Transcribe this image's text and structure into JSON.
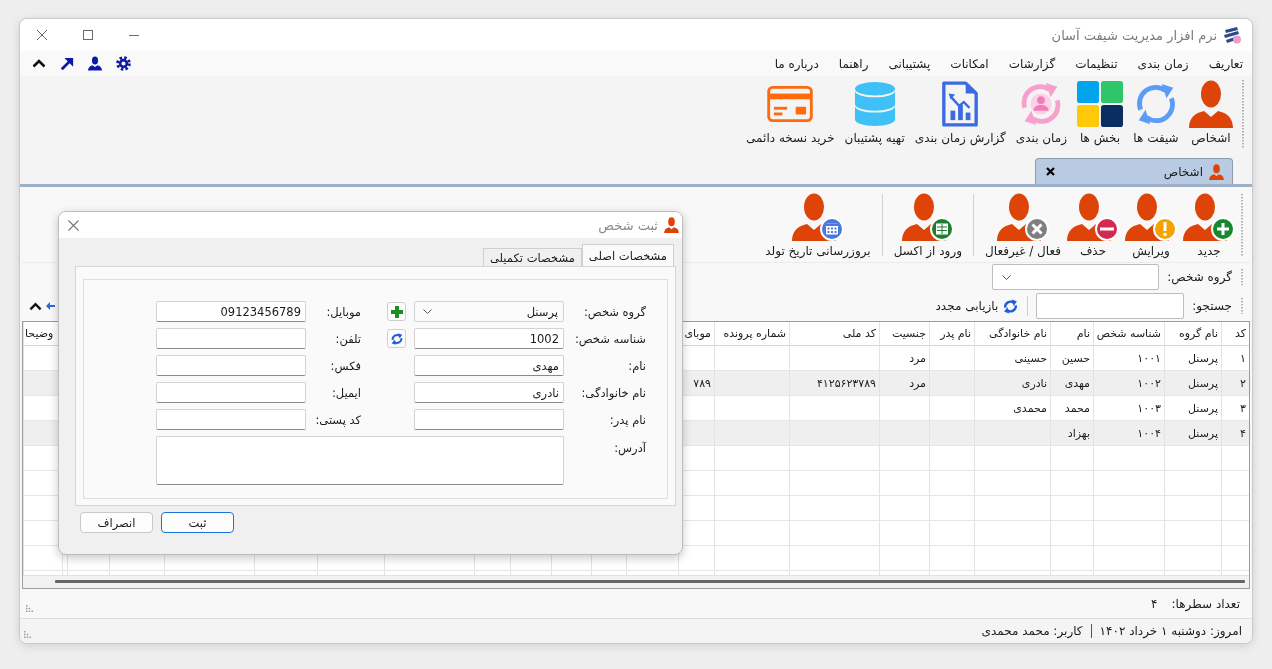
{
  "window": {
    "title": "نرم افزار مدیریت شیفت آسان"
  },
  "menu": [
    "تعاریف",
    "زمان بندی",
    "تنظیمات",
    "گزارشات",
    "امکانات",
    "پشتیبانی",
    "راهنما",
    "درباره ما"
  ],
  "ribbon": [
    {
      "kind": "person",
      "label": "اشخاص"
    },
    {
      "kind": "cycle",
      "label": "شیفت ها"
    },
    {
      "kind": "tiles",
      "label": "بخش ها"
    },
    {
      "kind": "schedule",
      "label": "زمان بندی"
    },
    {
      "kind": "report",
      "label": "گزارش زمان بندی"
    },
    {
      "kind": "database",
      "label": "تهیه پشتیبان"
    },
    {
      "kind": "card",
      "label": "خرید نسخه دائمی"
    }
  ],
  "doc_tabs": [
    {
      "label": "اشخاص",
      "selected": true
    }
  ],
  "toolbar": [
    {
      "buttons": [
        {
          "kind": "add",
          "label": "جدید"
        },
        {
          "kind": "warning",
          "label": "ویرایش"
        },
        {
          "kind": "remove",
          "label": "حذف"
        },
        {
          "kind": "deactivate",
          "label": "فعال / غیرفعال"
        }
      ]
    },
    {
      "buttons": [
        {
          "kind": "excel",
          "label": "ورود از اکسل"
        }
      ]
    },
    {
      "buttons": [
        {
          "kind": "calendar",
          "label": "بروزرسانی تاریخ تولد"
        }
      ]
    }
  ],
  "filter": {
    "group_label": "گروه شخص:",
    "search_label": "جستجو:",
    "reload_label": "بازیابی مجدد"
  },
  "table": {
    "columns": [
      "کد",
      "نام گروه",
      "شناسه شخص",
      "نام",
      "نام خانوادگی",
      "نام پدر",
      "جنسیت",
      "کد ملی",
      "شماره پرونده",
      "موبای",
      "وضیحا"
    ],
    "rows": [
      [
        "۱",
        "پرسنل",
        "۱۰۰۱",
        "حسین",
        "حسینی",
        null,
        "مرد",
        null,
        null,
        null,
        null
      ],
      [
        "۲",
        "پرسنل",
        "۱۰۰۲",
        "مهدی",
        "نادری",
        null,
        "مرد",
        "۴۱۲۵۶۲۳۷۸۹",
        null,
        "۷۸۹",
        null
      ],
      [
        "۳",
        "پرسنل",
        "۱۰۰۳",
        "محمد",
        "محمدی",
        null,
        null,
        null,
        null,
        null,
        null
      ],
      [
        "۴",
        "پرسنل",
        "۱۰۰۴",
        "بهزاد",
        null,
        null,
        null,
        null,
        null,
        null,
        null
      ]
    ]
  },
  "row_count": {
    "label": "تعداد سطرها:",
    "value": "۴"
  },
  "status_bar": {
    "date": "امروز: دوشنبه ۱ خرداد ۱۴۰۲",
    "user": "کاربر: محمد محمدی"
  },
  "dialog": {
    "title": "ثبت شخص",
    "tabs": [
      {
        "label": "مشخصات اصلی",
        "selected": true
      },
      {
        "label": "مشخصات تکمیلی",
        "selected": false
      }
    ],
    "person_fields": [
      {
        "kind": "dropdown",
        "label": "گروه شخص:",
        "value": "پرسنل",
        "side_button": {
          "kind": "add"
        }
      },
      {
        "kind": "text",
        "label": "شناسه شخص:",
        "value": "1002",
        "side_button": {
          "kind": "refresh"
        }
      },
      {
        "kind": "text",
        "label": "نام:",
        "value": "مهدی"
      },
      {
        "kind": "text",
        "label": "نام خانوادگی:",
        "value": "نادری"
      },
      {
        "kind": "text",
        "label": "نام پدر:"
      }
    ],
    "contact_fields": [
      {
        "label": "موبایل:",
        "value": "09123456789"
      },
      {
        "label": "تلفن:"
      },
      {
        "label": "فکس:"
      },
      {
        "label": "ایمیل:"
      },
      {
        "label": "کد پستی:"
      }
    ],
    "address": {
      "label": "آدرس:"
    },
    "buttons": [
      {
        "label": "ثبت",
        "default": true
      },
      {
        "label": "انصراف",
        "default": false
      }
    ]
  }
}
